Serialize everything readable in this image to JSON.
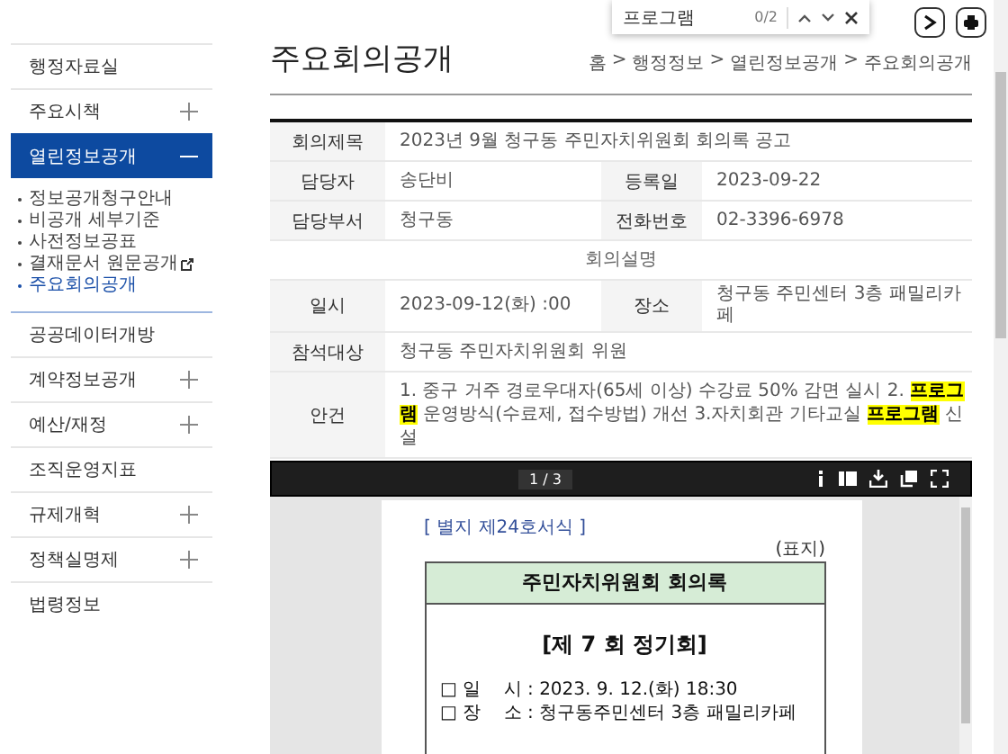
{
  "find_bar": {
    "query": "프로그램",
    "count": "0/2"
  },
  "sidebar": {
    "items": [
      {
        "kind": "link",
        "label": "행정자료실",
        "selected": false
      },
      {
        "kind": "group",
        "label": "주요시책",
        "expanded": false,
        "selected": false
      },
      {
        "kind": "group",
        "label": "열린정보공개",
        "expanded": true,
        "selected": true,
        "children": [
          {
            "label": "정보공개청구안내",
            "selected": false,
            "external": false
          },
          {
            "label": "비공개 세부기준",
            "selected": false,
            "external": false
          },
          {
            "label": "사전정보공표",
            "selected": false,
            "external": false
          },
          {
            "label": "결재문서 원문공개",
            "selected": false,
            "external": true
          },
          {
            "label": "주요회의공개",
            "selected": true,
            "external": false
          }
        ]
      },
      {
        "kind": "link",
        "label": "공공데이터개방",
        "selected": false
      },
      {
        "kind": "group",
        "label": "계약정보공개",
        "expanded": false,
        "selected": false
      },
      {
        "kind": "group",
        "label": "예산/재정",
        "expanded": false,
        "selected": false
      },
      {
        "kind": "link",
        "label": "조직운영지표",
        "selected": false
      },
      {
        "kind": "group",
        "label": "규제개혁",
        "expanded": false,
        "selected": false
      },
      {
        "kind": "group",
        "label": "정책실명제",
        "expanded": false,
        "selected": false
      },
      {
        "kind": "link",
        "label": "법령정보",
        "selected": false
      }
    ]
  },
  "page": {
    "title": "주요회의공개",
    "breadcrumb_separator": ">",
    "breadcrumb": [
      "홈",
      "행정정보",
      "열린정보공개",
      "주요회의공개"
    ]
  },
  "details": {
    "rows": [
      {
        "kind": "full",
        "label": "회의제목",
        "value": "2023년 9월 청구동 주민자치위원회 회의록 공고"
      },
      {
        "kind": "pair",
        "label": "담당자",
        "value": "송단비",
        "label_2": "등록일",
        "value_2": "2023-09-22"
      },
      {
        "kind": "pair",
        "label": "담당부서",
        "value": "청구동",
        "label_2": "전화번호",
        "value_2": "02-3396-6978"
      },
      {
        "kind": "section",
        "value": "회의설명"
      },
      {
        "kind": "pair",
        "label": "일시",
        "value": "2023-09-12(화) :00",
        "label_2": "장소",
        "value_2": "청구동 주민센터 3층 패밀리카페"
      },
      {
        "kind": "full",
        "label": "참석대상",
        "value": "청구동 주민자치위원회 위원"
      },
      {
        "kind": "segments",
        "label": "안건",
        "segments": [
          {
            "text": "1. 중구 거주 경로우대자(65세 이상) 수강료 50% 감면 실시 2. ",
            "highlight": false
          },
          {
            "text": "프로그램",
            "highlight": true
          },
          {
            "text": " 운영방식(수료제, 접수방법) 개선 3.자치회관 기타교실 ",
            "highlight": false
          },
          {
            "text": "프로그램",
            "highlight": true
          },
          {
            "text": " 신설",
            "highlight": false
          }
        ]
      }
    ]
  },
  "pdf_viewer": {
    "page_indicator": "1 / 3",
    "document": {
      "form_no": "[ 별지 제24호서식 ]",
      "cover_mark": "(표지)",
      "heading": "주민자치위원회 회의록",
      "session": "[제 7 회 정기회]",
      "lines": [
        {
          "bullet": "□",
          "label": "일    시",
          "value": ": 2023. 9. 12.(화) 18:30"
        },
        {
          "bullet": "□",
          "label": "장    소",
          "value": ": 청구동주민센터 3층 패밀리카페"
        }
      ]
    }
  }
}
